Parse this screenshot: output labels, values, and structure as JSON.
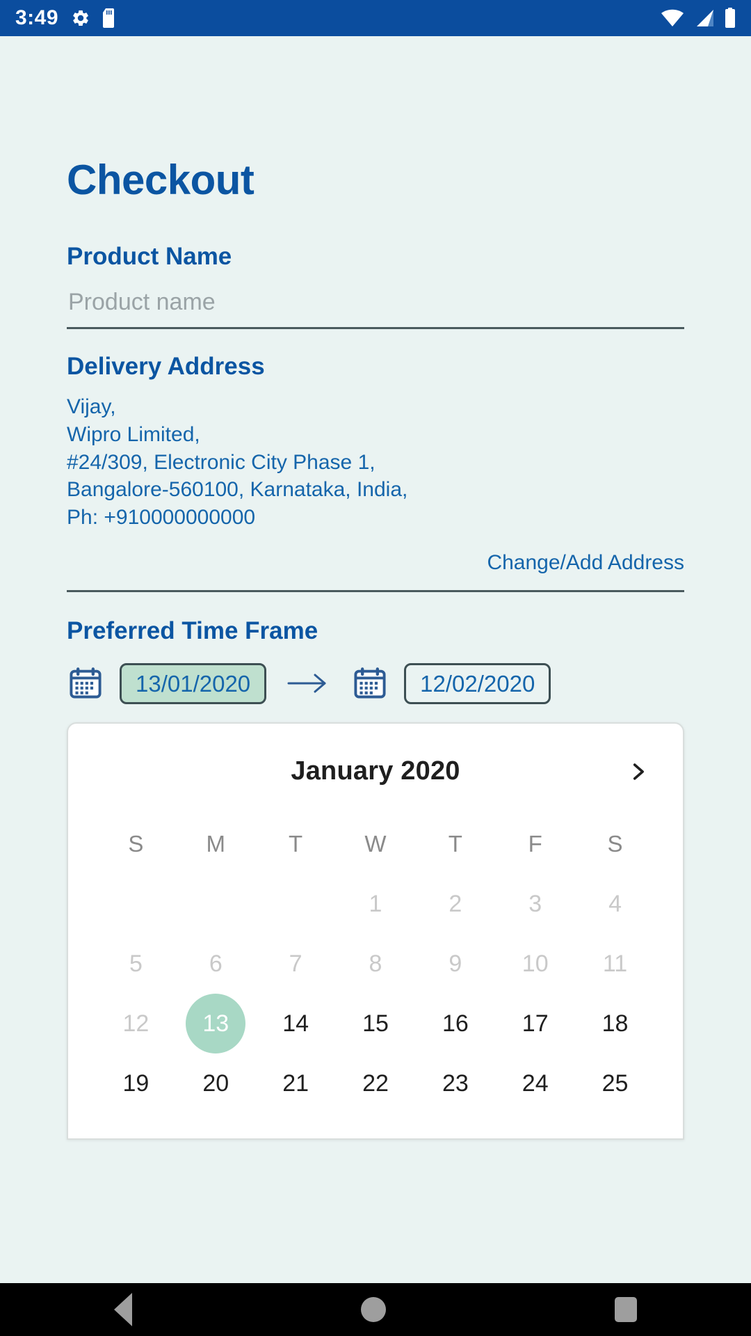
{
  "status_bar": {
    "time": "3:49",
    "icons_left": [
      "gear-icon",
      "sd-card-icon"
    ],
    "icons_right": [
      "wifi-icon",
      "signal-icon",
      "battery-icon"
    ],
    "background_color": "#0b4d9e"
  },
  "page": {
    "title": "Checkout",
    "accent_color": "#0b55a2",
    "background_color": "#eaf3f2"
  },
  "product": {
    "label": "Product Name",
    "value": "",
    "placeholder": "Product name"
  },
  "delivery": {
    "label": "Delivery Address",
    "lines": [
      "Vijay,",
      "Wipro Limited,",
      "#24/309, Electronic City Phase 1,",
      "Bangalore-560100, Karnataka, India,",
      "Ph: +910000000000"
    ],
    "change_link": "Change/Add Address"
  },
  "time_frame": {
    "label": "Preferred Time Frame",
    "start_date": "13/01/2020",
    "end_date": "12/02/2020",
    "arrow_icon": "arrow-right-icon",
    "start_icon": "calendar-icon",
    "end_icon": "calendar-icon",
    "selected_chip_color": "#bfe0cf"
  },
  "calendar": {
    "month_label": "January 2020",
    "next_icon": "chevron-right-icon",
    "weekdays": [
      "S",
      "M",
      "T",
      "W",
      "T",
      "F",
      "S"
    ],
    "selected_day": 13,
    "selected_color": "#a8d8c5",
    "cells": [
      {
        "label": "",
        "state": "empty"
      },
      {
        "label": "",
        "state": "empty"
      },
      {
        "label": "",
        "state": "empty"
      },
      {
        "label": "1",
        "state": "disabled"
      },
      {
        "label": "2",
        "state": "disabled"
      },
      {
        "label": "3",
        "state": "disabled"
      },
      {
        "label": "4",
        "state": "disabled"
      },
      {
        "label": "5",
        "state": "disabled"
      },
      {
        "label": "6",
        "state": "disabled"
      },
      {
        "label": "7",
        "state": "disabled"
      },
      {
        "label": "8",
        "state": "disabled"
      },
      {
        "label": "9",
        "state": "disabled"
      },
      {
        "label": "10",
        "state": "disabled"
      },
      {
        "label": "11",
        "state": "disabled"
      },
      {
        "label": "12",
        "state": "disabled"
      },
      {
        "label": "13",
        "state": "selected"
      },
      {
        "label": "14",
        "state": "enabled"
      },
      {
        "label": "15",
        "state": "enabled"
      },
      {
        "label": "16",
        "state": "enabled"
      },
      {
        "label": "17",
        "state": "enabled"
      },
      {
        "label": "18",
        "state": "enabled"
      },
      {
        "label": "19",
        "state": "enabled"
      },
      {
        "label": "20",
        "state": "enabled"
      },
      {
        "label": "21",
        "state": "enabled"
      },
      {
        "label": "22",
        "state": "enabled"
      },
      {
        "label": "23",
        "state": "enabled"
      },
      {
        "label": "24",
        "state": "enabled"
      },
      {
        "label": "25",
        "state": "enabled"
      }
    ]
  },
  "nav_bar": {
    "back": "back-icon",
    "home": "home-icon",
    "recents": "recents-icon"
  }
}
